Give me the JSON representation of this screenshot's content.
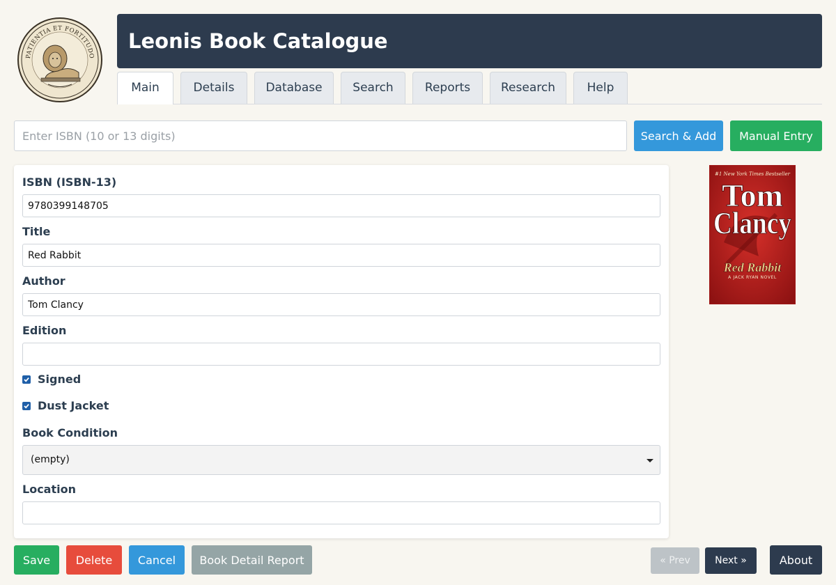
{
  "app": {
    "title": "Leonis Book Catalogue",
    "logo_motto": "PATIENTIA ET FORTITUDO"
  },
  "tabs": [
    {
      "label": "Main",
      "active": true
    },
    {
      "label": "Details",
      "active": false
    },
    {
      "label": "Database",
      "active": false
    },
    {
      "label": "Search",
      "active": false
    },
    {
      "label": "Reports",
      "active": false
    },
    {
      "label": "Research",
      "active": false
    },
    {
      "label": "Help",
      "active": false
    }
  ],
  "search": {
    "placeholder": "Enter ISBN (10 or 13 digits)",
    "value": "",
    "search_add_label": "Search & Add",
    "manual_entry_label": "Manual Entry"
  },
  "form": {
    "isbn_label": "ISBN (ISBN-13)",
    "isbn_value": "9780399148705",
    "title_label": "Title",
    "title_value": "Red Rabbit",
    "author_label": "Author",
    "author_value": "Tom Clancy",
    "edition_label": "Edition",
    "edition_value": "",
    "signed_label": "Signed",
    "signed_checked": true,
    "dust_jacket_label": "Dust Jacket",
    "dust_jacket_checked": true,
    "condition_label": "Book Condition",
    "condition_value": "(empty)",
    "location_label": "Location",
    "location_value": ""
  },
  "cover": {
    "banner": "#1 New York Times Bestseller",
    "author_line1": "Tom",
    "author_line2": "Clancy",
    "book_title": "Red Rabbit",
    "subtitle": "A JACK RYAN NOVEL"
  },
  "actions": {
    "save_label": "Save",
    "delete_label": "Delete",
    "cancel_label": "Cancel",
    "report_label": "Book Detail Report",
    "prev_label": "« Prev",
    "next_label": "Next »",
    "about_label": "About"
  },
  "colors": {
    "header_bg": "#2d3b4e",
    "primary_blue": "#3498db",
    "success_green": "#27ae60",
    "danger_red": "#e74c3c",
    "page_bg": "#f8f6f0"
  }
}
